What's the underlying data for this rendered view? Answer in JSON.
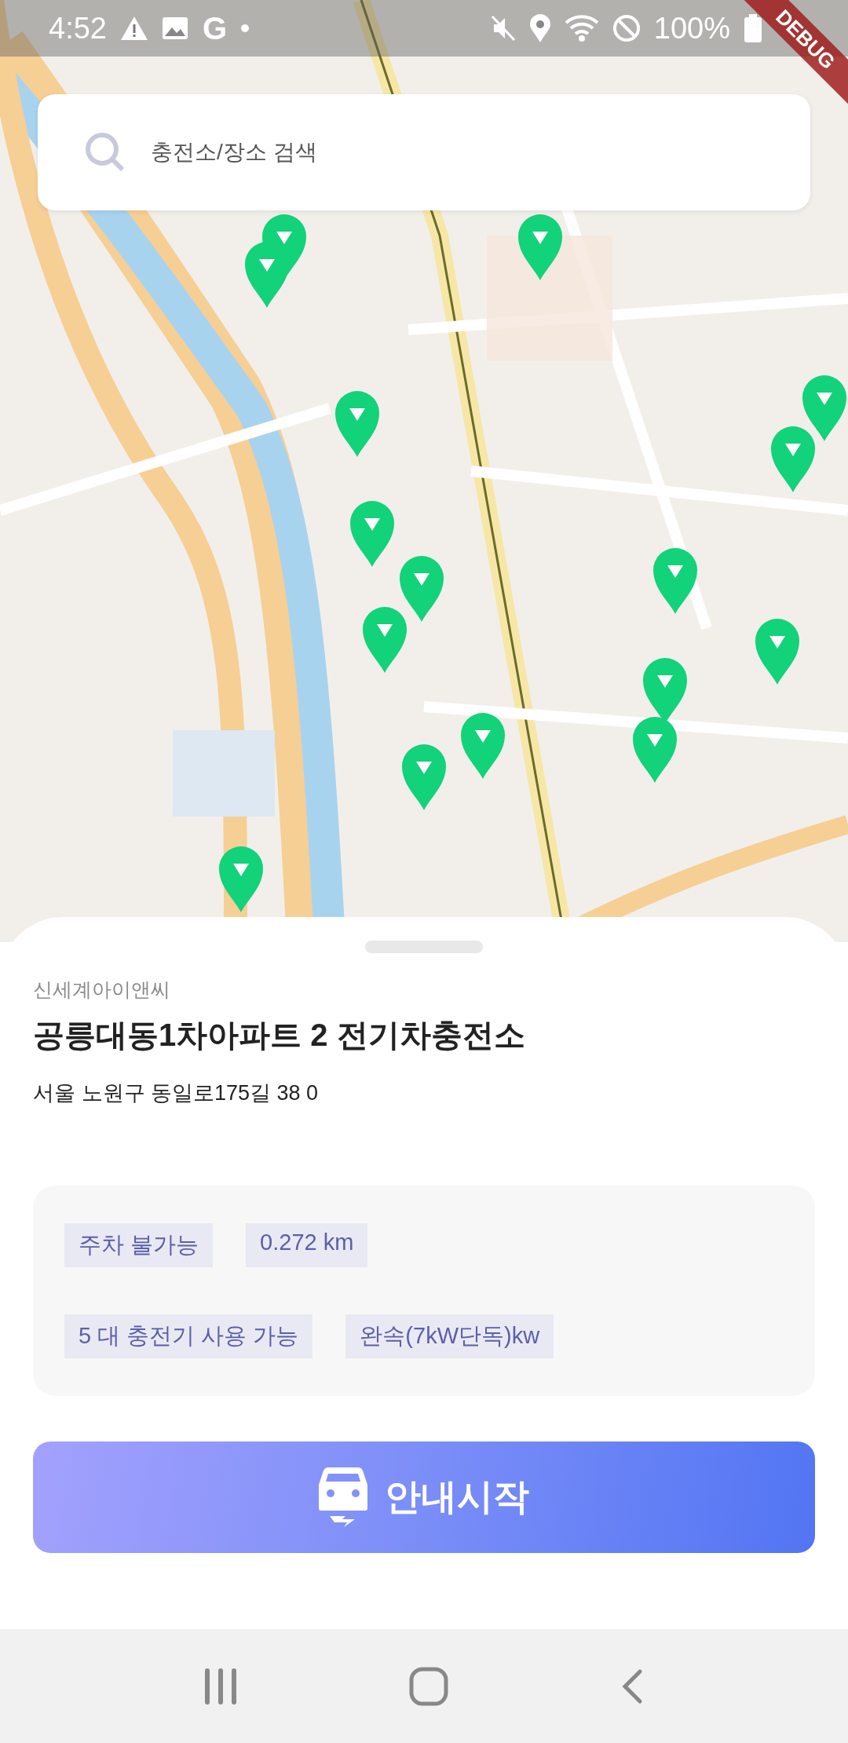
{
  "status_bar": {
    "time": "4:52",
    "app_badge": "G",
    "battery": "100%"
  },
  "debug_banner": "DEBUG",
  "search": {
    "placeholder": "충전소/장소 검색"
  },
  "station": {
    "operator": "신세계아이앤씨",
    "name": "공릉대동1차아파트 2 전기차충전소",
    "address": "서울 노원구 동일로175길 38 0",
    "tags": [
      "주차 불가능",
      "0.272 km",
      "5 대 충전기 사용 가능",
      "완속(7kW단독)kw"
    ]
  },
  "navigate_button": {
    "label": "안내시작"
  }
}
